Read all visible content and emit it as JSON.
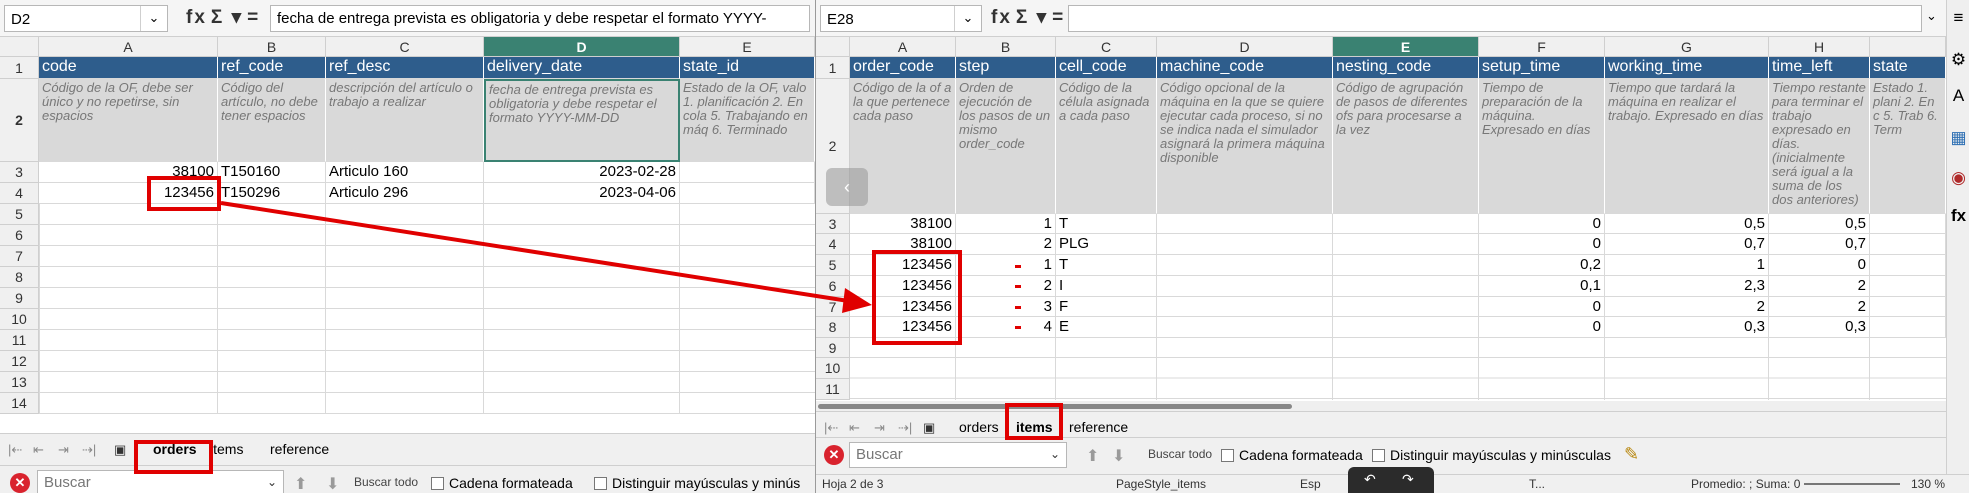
{
  "left": {
    "formula": {
      "cell_ref": "D2",
      "content": "fecha de entrega prevista es obligatoria y debe respetar el formato YYYY-"
    },
    "columns": [
      "A",
      "B",
      "C",
      "D",
      "E"
    ],
    "rows": [
      "1",
      "2",
      "3",
      "4",
      "5",
      "6",
      "7",
      "8",
      "9",
      "10",
      "11",
      "12",
      "13",
      "14"
    ],
    "header": {
      "a": "code",
      "b": "ref_code",
      "c": "ref_desc",
      "d": "delivery_date",
      "e": "state_id"
    },
    "desc": {
      "a": "Código de la OF, debe ser único y no repetirse, sin espacios",
      "b": "Código del artículo, no debe tener espacios",
      "c": "descripción del artículo o trabajo a realizar",
      "d": "fecha de entrega prevista es obligatoria y debe respetar el formato YYYY-MM-DD",
      "e": "Estado de la OF, valo 1. planificación 2. En cola 5. Trabajando en máq 6. Terminado"
    },
    "data": [
      {
        "code": "38100",
        "ref_code": "T150160",
        "ref_desc": "Articulo 160",
        "delivery_date": "2023-02-28"
      },
      {
        "code": "123456",
        "ref_code": "T150296",
        "ref_desc": "Articulo 296",
        "delivery_date": "2023-04-06"
      }
    ],
    "tabs": [
      "orders",
      "items",
      "reference"
    ],
    "active_tab": "orders",
    "find": {
      "placeholder": "Buscar",
      "find_all": "Buscar todo",
      "formatted": "Cadena formateada",
      "match_case": "Distinguir mayúsculas y minús"
    }
  },
  "right": {
    "formula": {
      "cell_ref": "E28",
      "content": ""
    },
    "columns": [
      "A",
      "B",
      "C",
      "D",
      "E",
      "F",
      "G",
      "H",
      ""
    ],
    "rows": [
      "1",
      "2",
      "3",
      "4",
      "5",
      "6",
      "7",
      "8",
      "9",
      "10",
      "11"
    ],
    "header": {
      "a": "order_code",
      "b": "step",
      "c": "cell_code",
      "d": "machine_code",
      "e": "nesting_code",
      "f": "setup_time",
      "g": "working_time",
      "h": "time_left",
      "i": "state"
    },
    "desc": {
      "a": "Código de la of a la que pertenece cada paso",
      "b": "Orden de ejecución de los pasos de un mismo order_code",
      "c": "Código de la célula asignada a cada paso",
      "d": "Código opcional de la máquina en la que se quiere ejecutar cada proceso, si no se indica nada el simulador asignará la primera máquina disponible",
      "e": "Código de agrupación de pasos de diferentes ofs para procesarse a la vez",
      "f": "Tiempo de preparación de la máquina. Expresado en días",
      "g": "Tiempo que tardará la máquina en realizar el trabajo. Expresado en días",
      "h": "Tiempo restante para terminar el trabajo expresado en días. (inicialmente será igual a la suma de los dos anteriores)",
      "i": "Estado 1. plani 2. En c 5. Trab 6. Term"
    },
    "data": [
      {
        "order_code": "38100",
        "step": "1",
        "cell_code": "T",
        "setup_time": "0",
        "working_time": "0,5",
        "time_left": "0,5"
      },
      {
        "order_code": "38100",
        "step": "2",
        "cell_code": "PLG",
        "setup_time": "0",
        "working_time": "0,7",
        "time_left": "0,7"
      },
      {
        "order_code": "123456",
        "step": "1",
        "cell_code": "T",
        "setup_time": "0,2",
        "working_time": "1",
        "time_left": "0"
      },
      {
        "order_code": "123456",
        "step": "2",
        "cell_code": "I",
        "setup_time": "0,1",
        "working_time": "2,3",
        "time_left": "2"
      },
      {
        "order_code": "123456",
        "step": "3",
        "cell_code": "F",
        "setup_time": "0",
        "working_time": "2",
        "time_left": "2"
      },
      {
        "order_code": "123456",
        "step": "4",
        "cell_code": "E",
        "setup_time": "0",
        "working_time": "0,3",
        "time_left": "0,3"
      }
    ],
    "tabs": [
      "orders",
      "items",
      "reference"
    ],
    "active_tab": "items",
    "find": {
      "placeholder": "Buscar",
      "find_all": "Buscar todo",
      "formatted": "Cadena formateada",
      "match_case": "Distinguir mayúsculas y minúsculas"
    },
    "status": {
      "sheet": "Hoja 2 de 3",
      "page_style": "PageStyle_items",
      "lang": "Esp",
      "sel_mode": "T...",
      "average": "Promedio: ; Suma: 0",
      "zoom": "130 %"
    }
  },
  "colors": {
    "header_bg": "#2e5d8c",
    "desc_bg": "#d9d9d9",
    "selected_col": "#3a8272",
    "highlight": "#e00000"
  },
  "icons": [
    "fx-icon",
    "sum-icon",
    "equals-icon",
    "first-sheet-icon",
    "prev-sheet-icon",
    "next-sheet-icon",
    "last-sheet-icon",
    "add-sheet-icon",
    "close-find-icon",
    "find-prev-icon",
    "find-next-icon",
    "properties-icon",
    "styles-icon",
    "gallery-icon",
    "navigator-icon",
    "functions-icon"
  ]
}
